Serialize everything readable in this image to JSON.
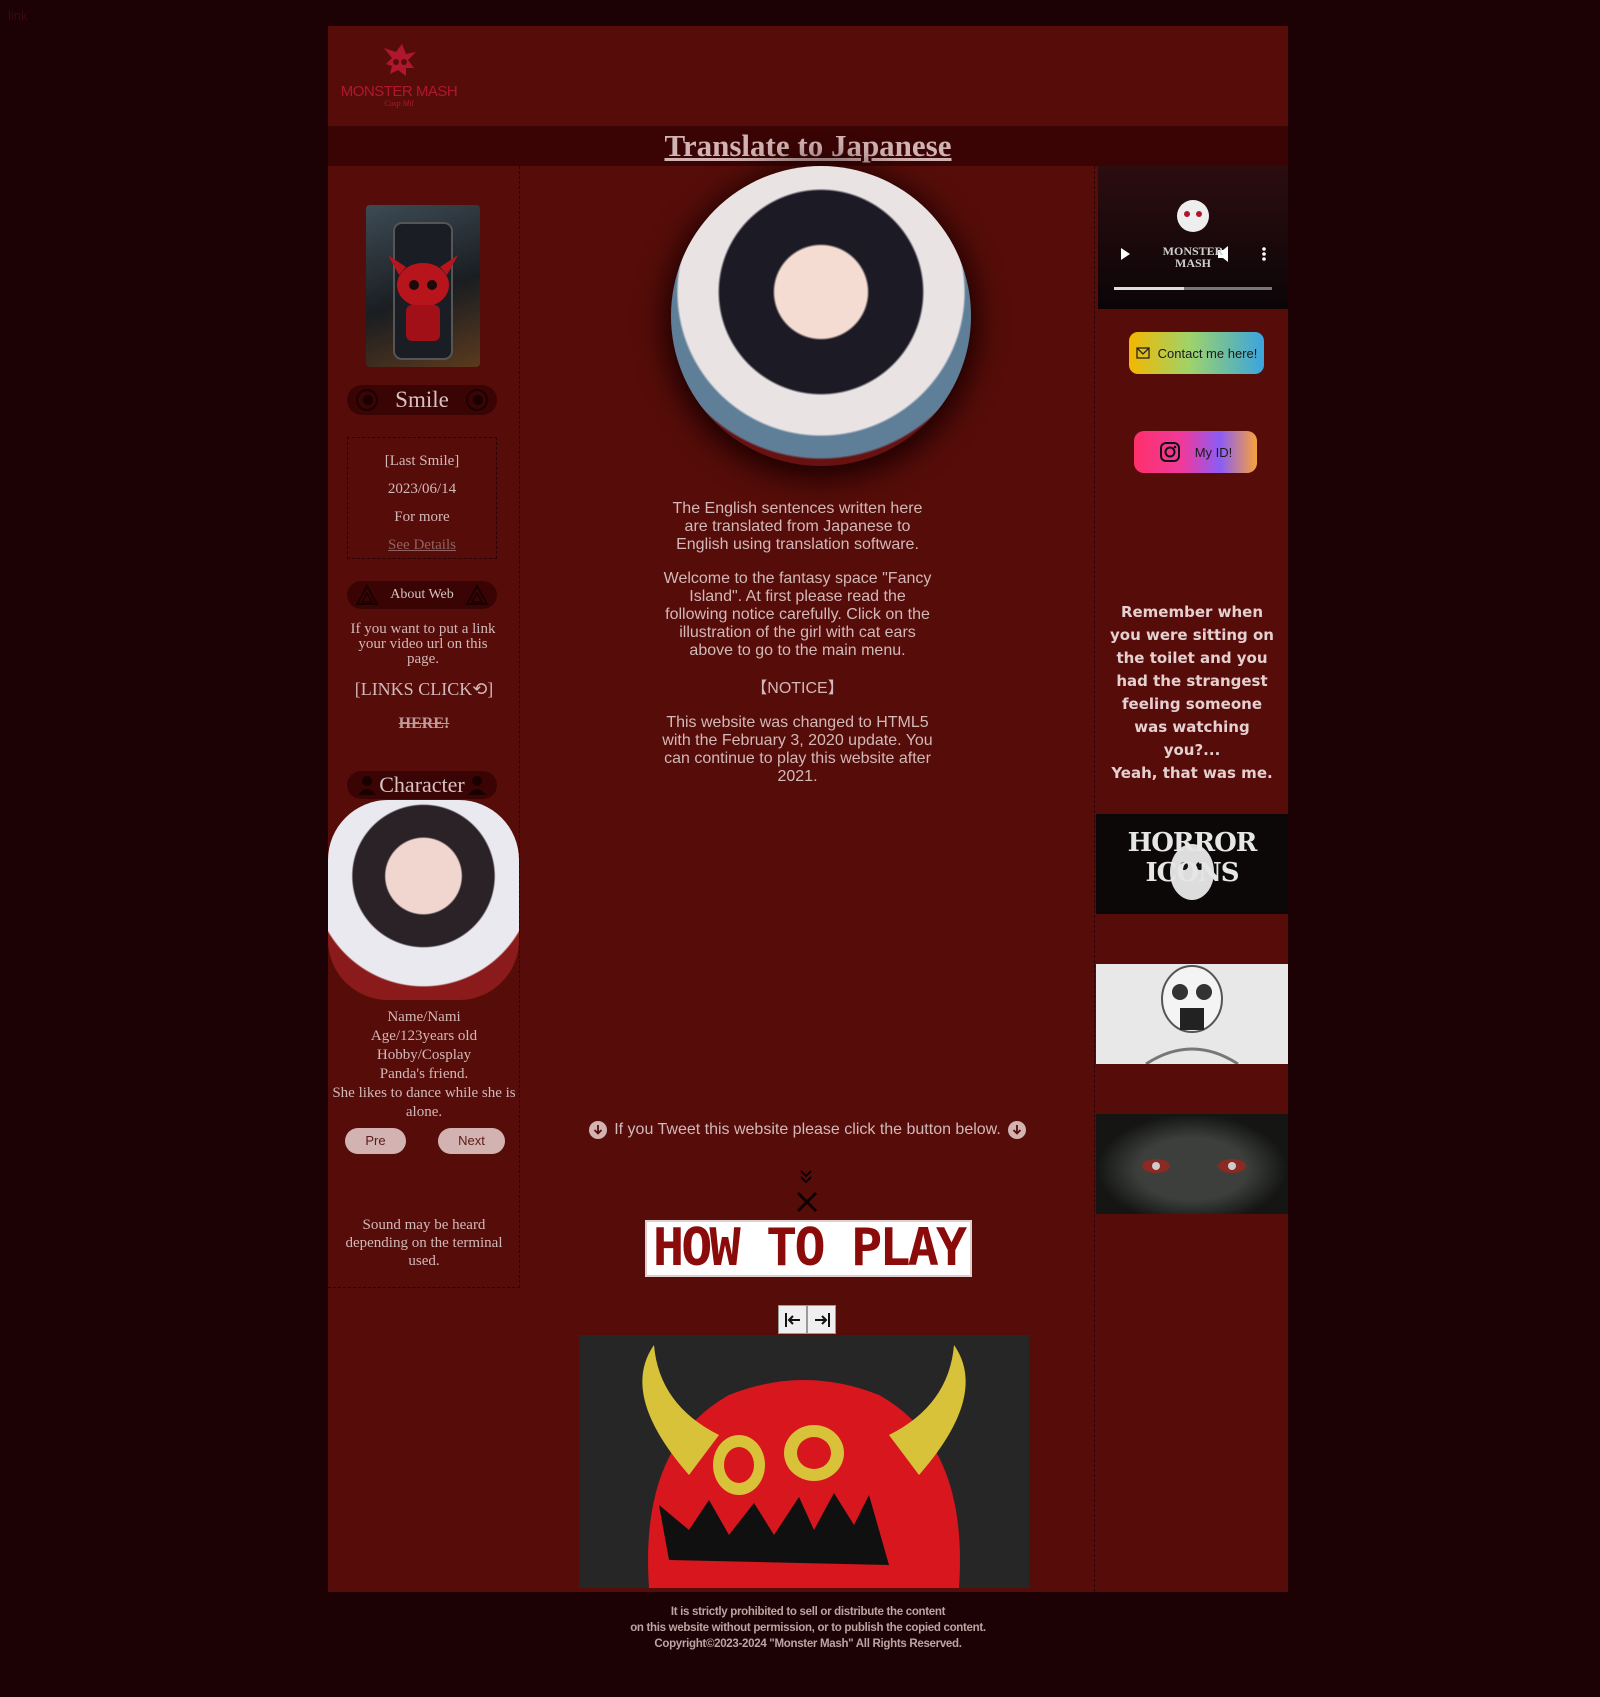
{
  "top_link": "link",
  "header": {
    "logo_text": "MONSTER MASH",
    "logo_sub": "Cosp Mil",
    "translate_link": "Translate to Japanese"
  },
  "left": {
    "smile_title": "Smile",
    "last_smile_label": "[Last Smile]",
    "last_smile_date": "2023/06/14",
    "for_more": "For more",
    "see_details": "See Details",
    "about_title": "About Web",
    "about_text": "If you want to put a link your video url on this page.",
    "links_click": "[LINKS CLICK⟲]",
    "here_link": "HERE!",
    "character_title": "Character",
    "character_info": [
      "Name/Nami",
      "Age/123years old",
      "Hobby/Cosplay",
      "Panda's friend.",
      "She likes to dance while she is alone."
    ],
    "pre_label": "Pre",
    "next_label": "Next",
    "sound_note": "Sound may be heard depending on the terminal used."
  },
  "center": {
    "intro": "The English sentences written here are translated from Japanese to English using translation software.",
    "welcome": "Welcome to the fantasy space \"Fancy Island\". At first please read the following notice carefully. Click on the illustration of the girl with cat ears above to go to the main menu.",
    "notice_title": "【NOTICE】",
    "notice_text": "This website was changed to HTML5 with the February 3, 2020 update. You can continue to play this website after 2021.",
    "tweet_text": "If you Tweet this website please click the button below.",
    "how_to_play": "HOW TO PLAY"
  },
  "right": {
    "video_brand": "MONSTER MASH",
    "contact_label": "Contact me here!",
    "insta_label": "My ID!",
    "quote": "Remember when you were sitting on the toilet and you had the strangest feeling someone was watching you?...\nYeah, that was me.",
    "thumb1_text": "HORROR ICONS"
  },
  "footer": {
    "line1": "It is strictly prohibited to sell or distribute the content",
    "line2": "on this website without permission, or to publish the copied content.",
    "line3": "Copyright©2023-2024 \"Monster Mash\" All Rights Reserved."
  },
  "colors": {
    "page_bg": "#1c0204",
    "frame_bg": "#560d09",
    "bar_bg": "#3a0404",
    "text": "#d2b9b9",
    "accent": "#b0172f"
  }
}
